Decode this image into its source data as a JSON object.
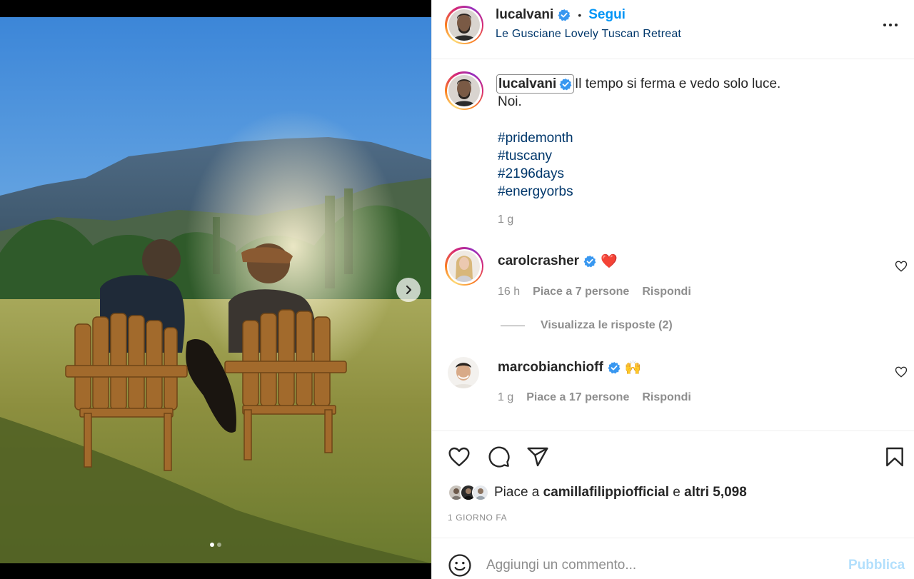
{
  "post": {
    "username": "lucalvani",
    "separator": "•",
    "follow_label": "Segui",
    "location": "Le Gusciane Lovely Tuscan Retreat",
    "caption": {
      "text_line1": "Il tempo si ferma e vedo solo luce.",
      "text_line2": "Noi.",
      "hashtags": [
        "#pridemonth",
        "#tuscany",
        "#2196days",
        "#energyorbs"
      ],
      "time": "1 g"
    },
    "comments": [
      {
        "username": "carolcrasher",
        "emoji": "❤️",
        "time": "16 h",
        "likes": "Piace a 7 persone",
        "reply_label": "Rispondi",
        "view_replies": "Visualizza le risposte (2)"
      },
      {
        "username": "marcobianchioff",
        "emoji": "🙌",
        "time": "1 g",
        "likes": "Piace a 17 persone",
        "reply_label": "Rispondi"
      }
    ],
    "likes_prefix": "Piace a",
    "likes_user": "camillafilippiofficial",
    "likes_suffix_connector": "e",
    "likes_others": "altri 5,098",
    "date": "1 GIORNO FA",
    "comment_placeholder": "Aggiungi un commento...",
    "publish_label": "Pubblica",
    "carousel": {
      "total": 2,
      "active": 1
    }
  },
  "colors": {
    "link_blue": "#0095f6",
    "hashtag_blue": "#00376b",
    "meta_gray": "#8e8e8e",
    "publish_disabled": "#b2dffc"
  },
  "icons": [
    "chevron-right-icon",
    "verified-badge-icon",
    "more-options-icon",
    "heart-icon",
    "comment-icon",
    "share-icon",
    "bookmark-icon",
    "emoji-icon"
  ]
}
